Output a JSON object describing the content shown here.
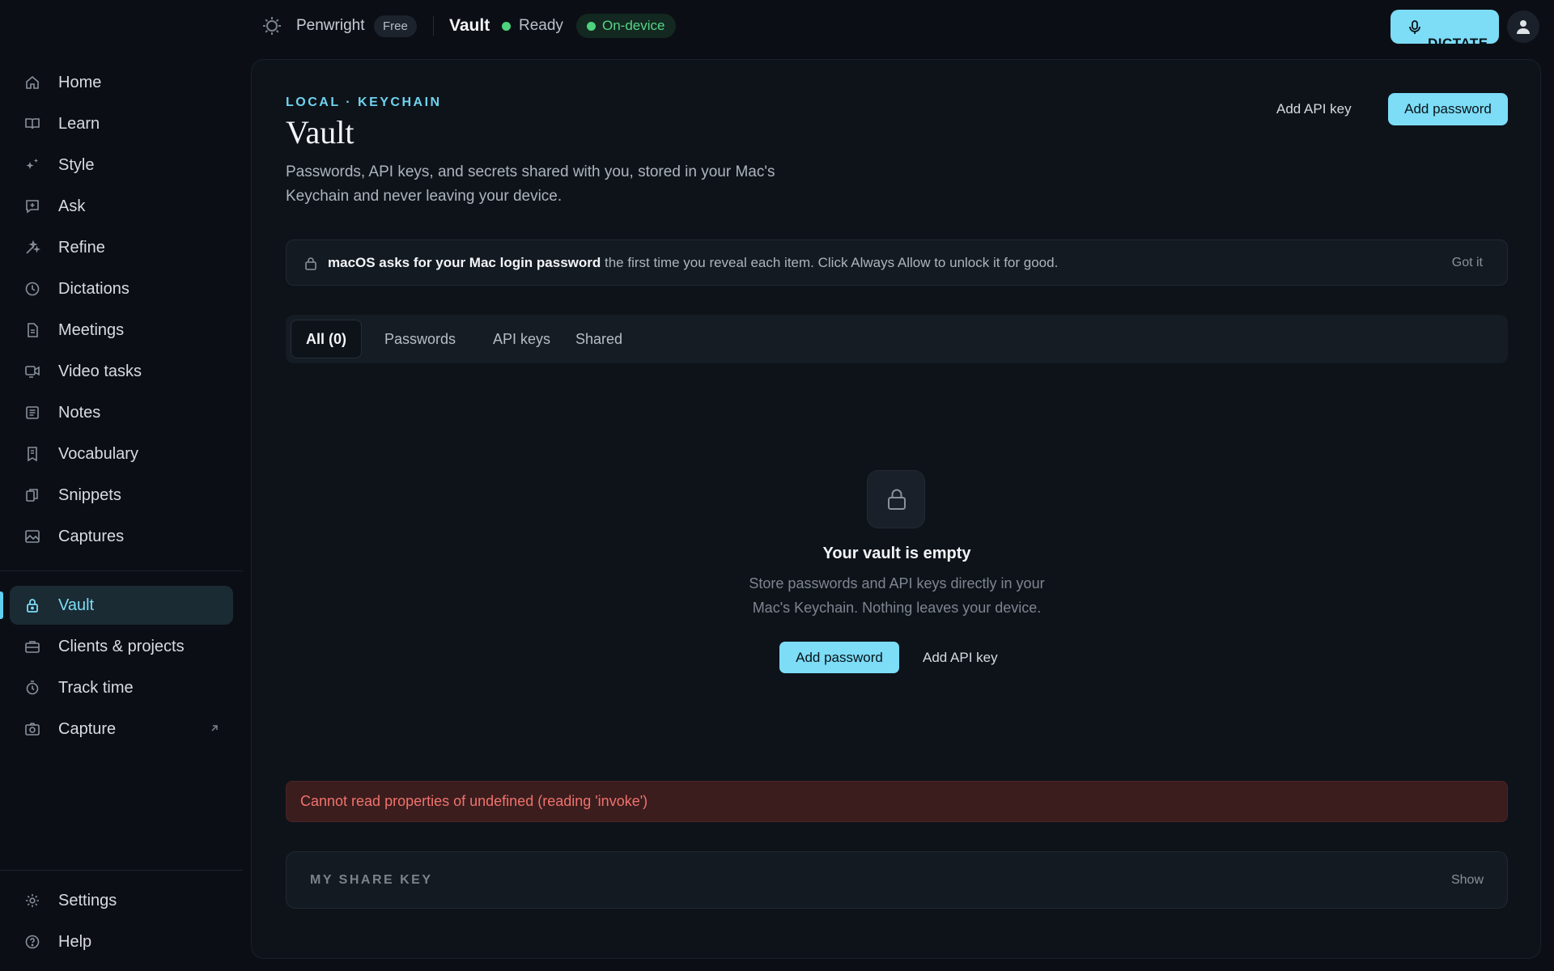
{
  "topbar": {
    "brand": "Penwright",
    "plan": "Free",
    "page": "Vault",
    "status": "Ready",
    "mode": "On-device",
    "dictate_label": "DICTATE"
  },
  "sidebar": {
    "items": [
      {
        "label": "Home",
        "icon": "home-icon"
      },
      {
        "label": "Learn",
        "icon": "book-icon"
      },
      {
        "label": "Style",
        "icon": "sparkle-icon"
      },
      {
        "label": "Ask",
        "icon": "chat-icon"
      },
      {
        "label": "Refine",
        "icon": "refine-icon"
      },
      {
        "label": "Dictations",
        "icon": "clock-icon"
      },
      {
        "label": "Meetings",
        "icon": "document-icon"
      },
      {
        "label": "Video tasks",
        "icon": "video-icon"
      },
      {
        "label": "Notes",
        "icon": "note-icon"
      },
      {
        "label": "Vocabulary",
        "icon": "bookmark-icon"
      },
      {
        "label": "Snippets",
        "icon": "snippet-icon"
      },
      {
        "label": "Captures",
        "icon": "image-icon"
      },
      {
        "label": "Vault",
        "icon": "lock-icon"
      },
      {
        "label": "Clients & projects",
        "icon": "briefcase-icon"
      },
      {
        "label": "Track time",
        "icon": "stopwatch-icon"
      },
      {
        "label": "Capture",
        "icon": "camera-icon"
      },
      {
        "label": "Settings",
        "icon": "gear-icon"
      },
      {
        "label": "Help",
        "icon": "help-icon"
      }
    ],
    "active": "Vault"
  },
  "header": {
    "eyebrow": "LOCAL · KEYCHAIN",
    "title": "Vault",
    "description": "Passwords, API keys, and secrets shared with you, stored in your Mac's Keychain and never leaving your device.",
    "add_api_key": "Add API key",
    "add_password": "Add password"
  },
  "notice": {
    "bold": "macOS asks for your Mac login password",
    "rest": " the first time you reveal each item. Click Always Allow to unlock it for good.",
    "dismiss": "Got it"
  },
  "tabs": [
    {
      "label": "All (0)",
      "active": true
    },
    {
      "label": "Passwords",
      "active": false
    },
    {
      "label": "API keys",
      "active": false
    },
    {
      "label": "Shared",
      "active": false
    }
  ],
  "empty": {
    "title": "Your vault is empty",
    "description": "Store passwords and API keys directly in your Mac's Keychain. Nothing leaves your device.",
    "primary": "Add password",
    "secondary": "Add API key"
  },
  "error": "Cannot read properties of undefined (reading 'invoke')",
  "share_key": {
    "label": "MY SHARE KEY",
    "action": "Show"
  },
  "colors": {
    "accent": "#7ddcf6",
    "success": "#4ed27e",
    "error": "#f0736c",
    "background": "#0b0f15"
  }
}
